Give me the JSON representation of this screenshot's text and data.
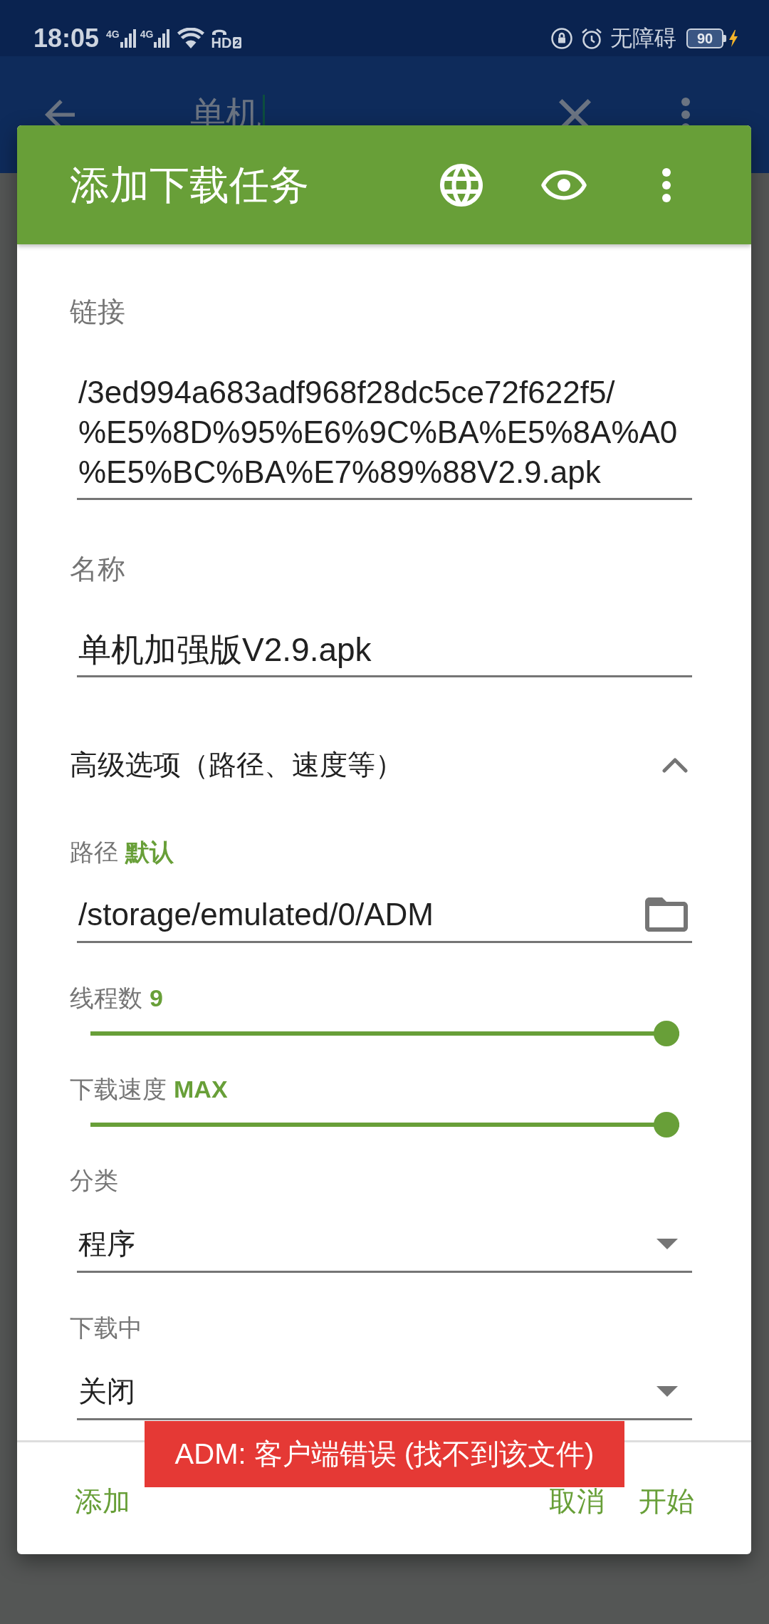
{
  "status_bar": {
    "time": "18:05",
    "signals": [
      {
        "network": "4G"
      },
      {
        "network": "4G"
      }
    ],
    "hd_call": {
      "label": "HD",
      "sim": "2"
    },
    "accessibility": "无障碍",
    "battery": "90",
    "charging": true
  },
  "background_app_bar": {
    "search": {
      "value": "单机",
      "focused": true
    }
  },
  "dialog": {
    "title": "添加下载任务",
    "fields": [
      {
        "kind": "multiline",
        "label": "链接",
        "lines": [
          "/3ed994a683adf968f28dc5ce72f622f5/",
          "%E5%8D%95%E6%9C%BA%E5%8A%A0",
          "%E5%BC%BA%E7%89%88V2.9.apk"
        ]
      },
      {
        "kind": "text",
        "label": "名称",
        "value": "单机加强版V2.9.apk"
      },
      {
        "kind": "section",
        "label": "高级选项（路径、速度等）",
        "expanded": true,
        "children": [
          {
            "kind": "path",
            "label": "路径",
            "badge": "默认",
            "value": "/storage/emulated/0/ADM"
          },
          {
            "kind": "slider",
            "label": "线程数",
            "reading": "9",
            "level": 1
          },
          {
            "kind": "slider",
            "label": "下载速度",
            "reading": "MAX",
            "level": 1
          },
          {
            "kind": "dropdown",
            "label": "分类",
            "value": "程序"
          },
          {
            "kind": "dropdown",
            "label": "下载中",
            "value": "关闭"
          }
        ]
      }
    ],
    "buttons": [
      "添加",
      "取消",
      "开始"
    ]
  },
  "toast": "ADM: 客户端错误 (找不到该文件)"
}
